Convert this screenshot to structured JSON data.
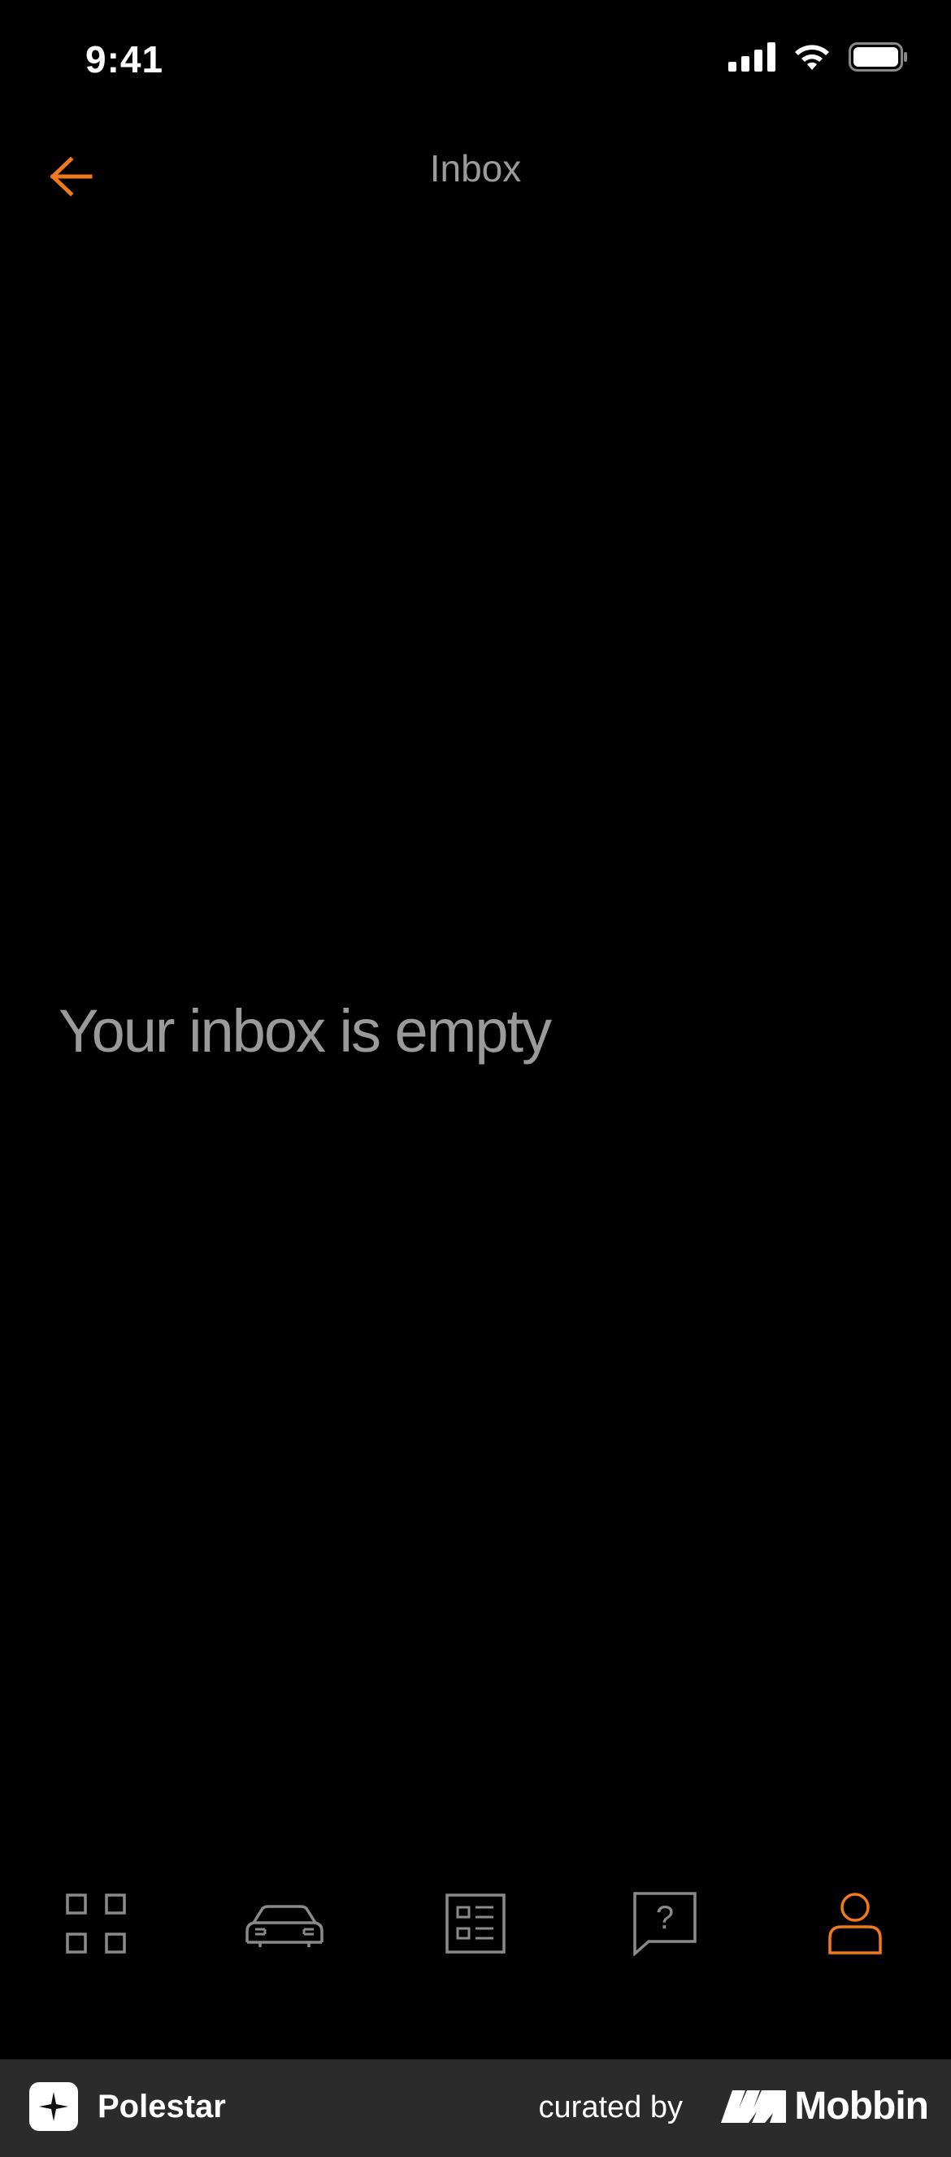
{
  "status_bar": {
    "time": "9:41"
  },
  "nav": {
    "title": "Inbox",
    "back_icon": "arrow-left-icon"
  },
  "main": {
    "empty_message": "Your inbox is empty"
  },
  "tab_bar": {
    "tabs": [
      {
        "icon": "grid-icon",
        "active": false
      },
      {
        "icon": "car-icon",
        "active": false
      },
      {
        "icon": "list-icon",
        "active": false
      },
      {
        "icon": "help-icon",
        "active": false
      },
      {
        "icon": "profile-icon",
        "active": true
      }
    ]
  },
  "footer": {
    "brand": "Polestar",
    "curated_by": "curated by",
    "mobbin": "Mobbin"
  },
  "colors": {
    "accent": "#f07a1a",
    "inactive": "#8a8a8a",
    "background": "#000000",
    "footer_bg": "#2b2b2b"
  }
}
